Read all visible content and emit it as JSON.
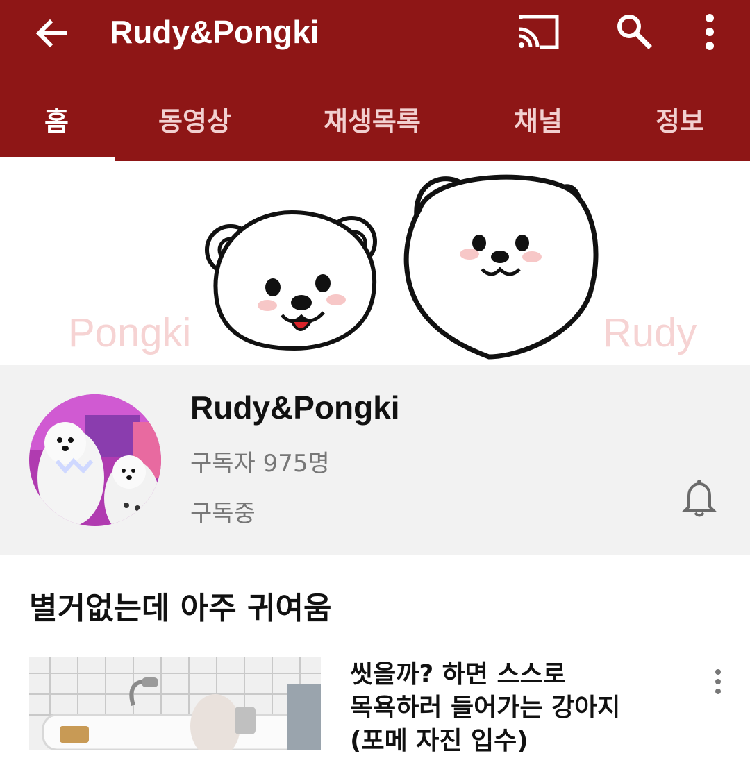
{
  "app_bar": {
    "title": "Rudy&Pongki",
    "icons": [
      "back-arrow-icon",
      "cast-icon",
      "search-icon",
      "more-vert-icon"
    ],
    "background_color": "#8e1616"
  },
  "tabs": [
    {
      "label": "홈",
      "active": true
    },
    {
      "label": "동영상",
      "active": false
    },
    {
      "label": "재생목록",
      "active": false
    },
    {
      "label": "채널",
      "active": false
    },
    {
      "label": "정보",
      "active": false
    }
  ],
  "banner": {
    "left_label": "Pongki",
    "right_label": "Rudy"
  },
  "channel": {
    "name": "Rudy&Pongki",
    "subscribers": "구독자 975명",
    "status": "구독중",
    "icons": [
      "avatar",
      "bell-icon"
    ]
  },
  "section": {
    "title": "별거없는데 아주 귀여움"
  },
  "video": {
    "title": "씻을까? 하면 스스로\n목욕하러 들어가는 강아지\n(포메 자진 입수)"
  }
}
